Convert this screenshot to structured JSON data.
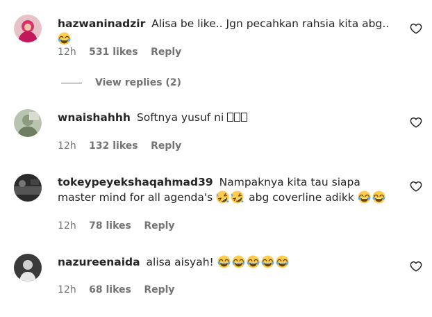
{
  "comments": [
    {
      "username": "hazwaninadzir",
      "text": "Alisa be like.. Jgn pecahkan rahsia kita abg..",
      "emoji": "😂",
      "time": "12h",
      "likes": "531 likes",
      "reply": "Reply",
      "view_replies": "View replies (2)"
    },
    {
      "username": "wnaishahhh",
      "text": "Softnya yusuf ni",
      "time": "12h",
      "likes": "132 likes",
      "reply": "Reply"
    },
    {
      "username": "tokeypeyekshaqahmad39",
      "text_part1": "Nampaknya kita tau siapa master mind for all agenda's",
      "text_part2": "abg coverline adikk",
      "time": "12h",
      "likes": "78 likes",
      "reply": "Reply"
    },
    {
      "username": "nazureenaida",
      "text": "alisa aisyah!",
      "time": "12h",
      "likes": "68 likes",
      "reply": "Reply"
    }
  ],
  "icons": {
    "like": "heart-outline-icon",
    "emoji_joy": "face-with-tears-of-joy",
    "emoji_rofl": "rolling-on-floor-laughing",
    "missing_glyph": "box-glyph"
  },
  "colors": {
    "text": "#262626",
    "secondary": "#737373",
    "emoji_face": "#FFCC4D",
    "emoji_tears": "#5DADEC"
  }
}
